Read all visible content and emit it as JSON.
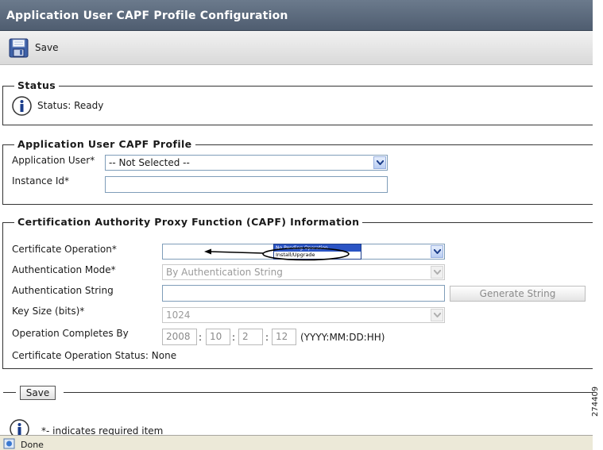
{
  "window": {
    "title": "Application User CAPF Profile Configuration"
  },
  "toolbar": {
    "save_label": "Save"
  },
  "status": {
    "legend": "Status",
    "text": "Status: Ready"
  },
  "profile": {
    "legend": "Application User CAPF Profile",
    "application_user_label": "Application User",
    "application_user_value": "-- Not Selected --",
    "instance_id_label": "Instance Id",
    "instance_id_value": "",
    "required_mark": "*"
  },
  "capf": {
    "legend": "Certification Authority Proxy Function (CAPF) Information",
    "certificate_operation_label": "Certificate Operation",
    "certificate_operation_value": "",
    "dropdown_options": [
      "No Pending Operation",
      "Install/Upgrade"
    ],
    "authentication_mode_label": "Authentication Mode",
    "authentication_mode_value": "By Authentication String",
    "authentication_string_label": "Authentication String",
    "authentication_string_value": "",
    "generate_string_label": "Generate String",
    "key_size_label": "Key Size (bits)",
    "key_size_value": "1024",
    "operation_completes_label": "Operation Completes By",
    "year": "2008",
    "month": "10",
    "day": "2",
    "hour": "12",
    "separator": ":",
    "date_format": "(YYYY:MM:DD:HH)",
    "certificate_status": "Certificate Operation Status: None"
  },
  "footer": {
    "save_label": "Save",
    "required_note": "*- indicates required item"
  },
  "statusbar": {
    "text": "Done"
  },
  "figure_id": "274409"
}
